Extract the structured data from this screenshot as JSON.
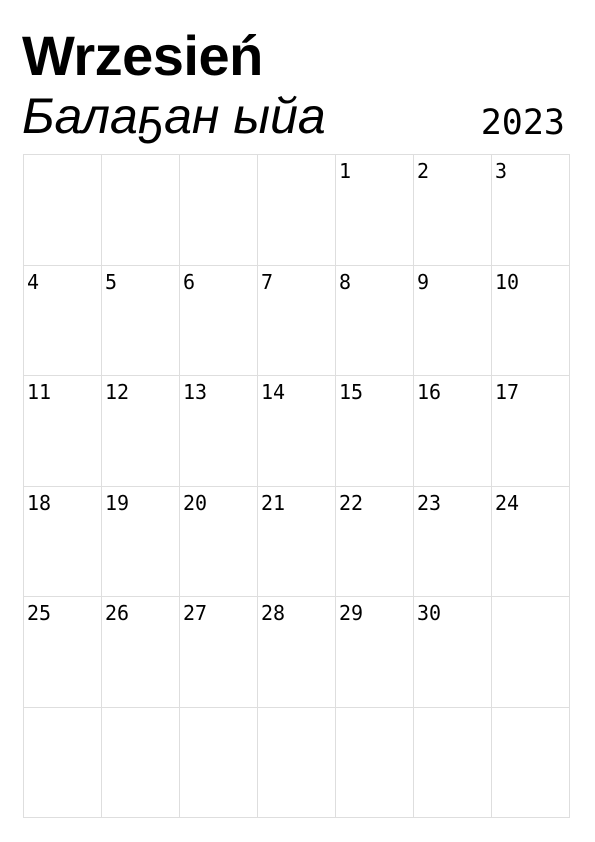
{
  "header": {
    "month_polish": "Wrzesień",
    "month_yakut": "Балаҕан ыйа",
    "year": "2023"
  },
  "calendar": {
    "weeks": [
      [
        "",
        "",
        "",
        "",
        "1",
        "2",
        "3"
      ],
      [
        "4",
        "5",
        "6",
        "7",
        "8",
        "9",
        "10"
      ],
      [
        "11",
        "12",
        "13",
        "14",
        "15",
        "16",
        "17"
      ],
      [
        "18",
        "19",
        "20",
        "21",
        "22",
        "23",
        "24"
      ],
      [
        "25",
        "26",
        "27",
        "28",
        "29",
        "30",
        ""
      ],
      [
        "",
        "",
        "",
        "",
        "",
        "",
        ""
      ]
    ]
  },
  "colors": {
    "grid_line": "#dedede",
    "text": "#000000",
    "background": "#ffffff"
  }
}
